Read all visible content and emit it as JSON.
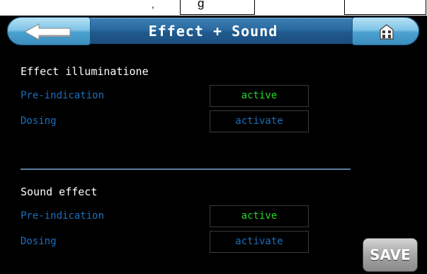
{
  "topbar": {
    "box1_text": "g",
    "box2_text": ""
  },
  "header": {
    "title": "Effect + Sound"
  },
  "sections": [
    {
      "title": "Effect illuminatione",
      "rows": [
        {
          "label": "Pre-indication",
          "value": "active"
        },
        {
          "label": "Dosing",
          "value": "activate"
        }
      ]
    },
    {
      "title": "Sound effect",
      "rows": [
        {
          "label": "Pre-indication",
          "value": "active"
        },
        {
          "label": "Dosing",
          "value": "activate"
        }
      ]
    }
  ],
  "buttons": {
    "save": "SAVE"
  },
  "icons": {
    "back": "back-arrow-icon",
    "home": "home-icon"
  },
  "colors": {
    "accent": "#1a6fc0",
    "active": "#27d52e",
    "titlebar": "#2a6aa0",
    "background": "#000000"
  }
}
